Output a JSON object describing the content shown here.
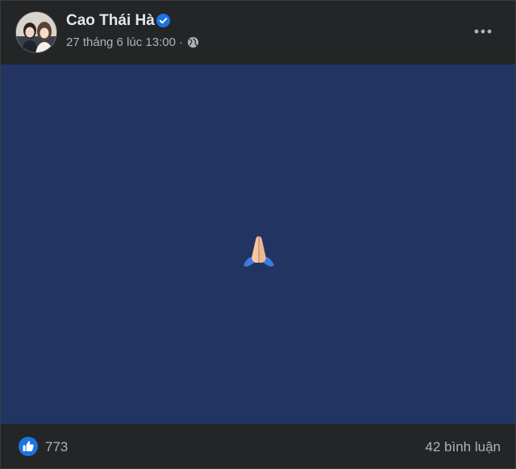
{
  "post": {
    "author": "Cao Thái Hà",
    "timestamp": "27 tháng 6 lúc 13:00",
    "separator": "·",
    "privacy_icon": "globe-icon",
    "verified_icon": "verified-badge-icon",
    "more_icon": "more-options-icon",
    "image_content": "🙏",
    "reactions": {
      "count": "773",
      "icon": "like-reaction-icon"
    },
    "comments": "42 bình luận"
  },
  "colors": {
    "background": "#242526",
    "image_background": "#223462",
    "text_primary": "#e4e6eb",
    "text_secondary": "#b0b3b8",
    "accent": "#1b74e4"
  }
}
